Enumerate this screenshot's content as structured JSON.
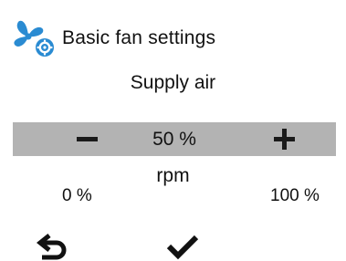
{
  "header": {
    "icon": "fan-settings-icon",
    "title": "Basic fan settings"
  },
  "subtitle": "Supply air",
  "control": {
    "decrease_icon": "minus-icon",
    "increase_icon": "plus-icon",
    "value": "50 %",
    "level_percent": 50
  },
  "unit": "rpm",
  "range": {
    "min": "0 %",
    "max": "100 %"
  },
  "footer": {
    "back_icon": "back-arrow-icon",
    "confirm_icon": "checkmark-icon"
  },
  "colors": {
    "bar": "#b3b3b3",
    "icon_blue": "#2a8bd2",
    "text": "#111111"
  }
}
